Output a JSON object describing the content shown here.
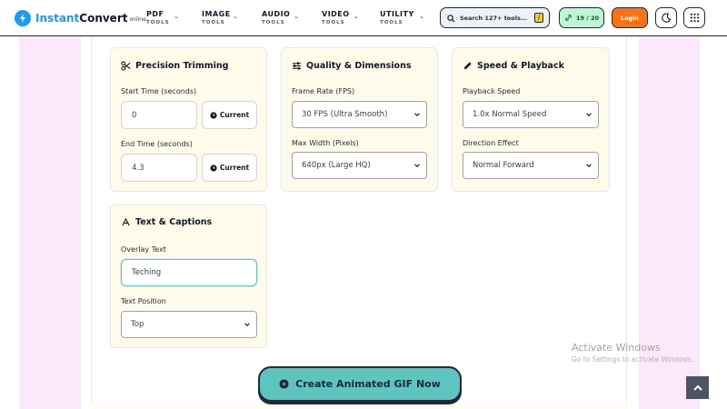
{
  "header": {
    "logo": {
      "brand": "Instant",
      "rest": "Convert",
      "suffix": "online"
    },
    "nav": [
      {
        "title": "PDF",
        "sub": "TOOLS"
      },
      {
        "title": "IMAGE",
        "sub": "TOOLS"
      },
      {
        "title": "AUDIO",
        "sub": "TOOLS"
      },
      {
        "title": "VIDEO",
        "sub": "TOOLS"
      },
      {
        "title": "UTILITY",
        "sub": "TOOLS"
      }
    ],
    "search": {
      "placeholder": "Search 127+ tools...",
      "shortcut": "/"
    },
    "counter": "19 / 20",
    "login": "Login"
  },
  "cards": {
    "trim": {
      "title": "Precision Trimming",
      "start_label": "Start Time (seconds)",
      "start_value": "0",
      "end_label": "End Time (seconds)",
      "end_value": "4.3",
      "current_label": "Current"
    },
    "quality": {
      "title": "Quality & Dimensions",
      "fps_label": "Frame Rate (FPS)",
      "fps_value": "30 FPS (Ultra Smooth)",
      "width_label": "Max Width (Pixels)",
      "width_value": "640px (Large HQ)"
    },
    "speed": {
      "title": "Speed & Playback",
      "speed_label": "Playback Speed",
      "speed_value": "1.0x Normal Speed",
      "dir_label": "Direction Effect",
      "dir_value": "Normal Forward"
    },
    "text": {
      "title": "Text & Captions",
      "overlay_label": "Overlay Text",
      "overlay_value": "Teching",
      "position_label": "Text Position",
      "position_value": "Top"
    }
  },
  "create_button": "Create Animated GIF Now",
  "watermark": {
    "title": "Activate Windows",
    "sub": "Go to Settings to activate Windows."
  },
  "colors": {
    "accent": "#5ec4c0",
    "login": "#f97316",
    "counter": "#bbf7d0",
    "card_bg": "#fffbea",
    "stripe": "#fbe9fb",
    "logo_blue": "#1d9bf0"
  }
}
